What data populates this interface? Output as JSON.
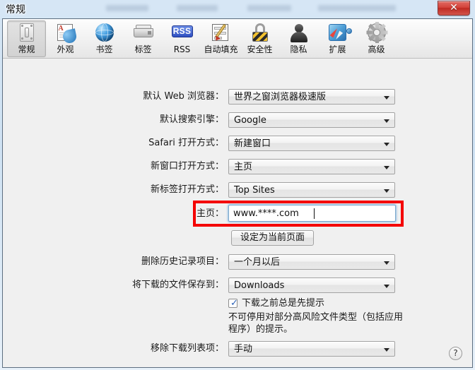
{
  "window": {
    "title": "常规",
    "close_label": "✕"
  },
  "toolbar": {
    "tabs": [
      {
        "label": "常规",
        "icon": "general-icon",
        "selected": true
      },
      {
        "label": "外观",
        "icon": "appearance-icon",
        "selected": false
      },
      {
        "label": "书签",
        "icon": "globe-icon",
        "selected": false
      },
      {
        "label": "标签",
        "icon": "tabs-icon",
        "selected": false
      },
      {
        "label": "RSS",
        "icon": "rss-icon",
        "selected": false
      },
      {
        "label": "自动填充",
        "icon": "autofill-icon",
        "selected": false
      },
      {
        "label": "安全性",
        "icon": "lock-icon",
        "selected": false
      },
      {
        "label": "隐私",
        "icon": "person-icon",
        "selected": false
      },
      {
        "label": "扩展",
        "icon": "puzzle-icon",
        "selected": false
      },
      {
        "label": "高级",
        "icon": "gear-icon",
        "selected": false
      }
    ],
    "rss_badge_text": "RSS"
  },
  "form": {
    "default_browser": {
      "label": "默认 Web 浏览器：",
      "value": "世界之窗浏览器极速版"
    },
    "default_search": {
      "label": "默认搜索引擎：",
      "value": "Google"
    },
    "safari_open": {
      "label": "Safari 打开方式：",
      "value": "新建窗口"
    },
    "new_window_open": {
      "label": "新窗口打开方式：",
      "value": "主页"
    },
    "new_tab_open": {
      "label": "新标签打开方式：",
      "value": "Top Sites"
    },
    "homepage": {
      "label": "主页：",
      "value": "www.****.com"
    },
    "set_current_page": {
      "label": "设定为当前页面"
    },
    "remove_history": {
      "label": "删除历史记录项目：",
      "value": "一个月以后"
    },
    "download_location": {
      "label": "将下载的文件保存到：",
      "value": "Downloads"
    },
    "always_prompt": {
      "label": "下载之前总是先提示",
      "checked": true
    },
    "prompt_note": "不可停用对部分高风险文件类型（包括应用程序）的提示。",
    "remove_list_items": {
      "label": "移除下载列表项：",
      "value": "手动"
    }
  },
  "help": {
    "label": "?"
  },
  "colors": {
    "window_bg": "#f0f0f0",
    "titlebar_gradient_top": "#d6e6f5",
    "accent_focus": "#7ea9cc",
    "annotation_red": "#f40000",
    "close_red": "#d4443c"
  }
}
